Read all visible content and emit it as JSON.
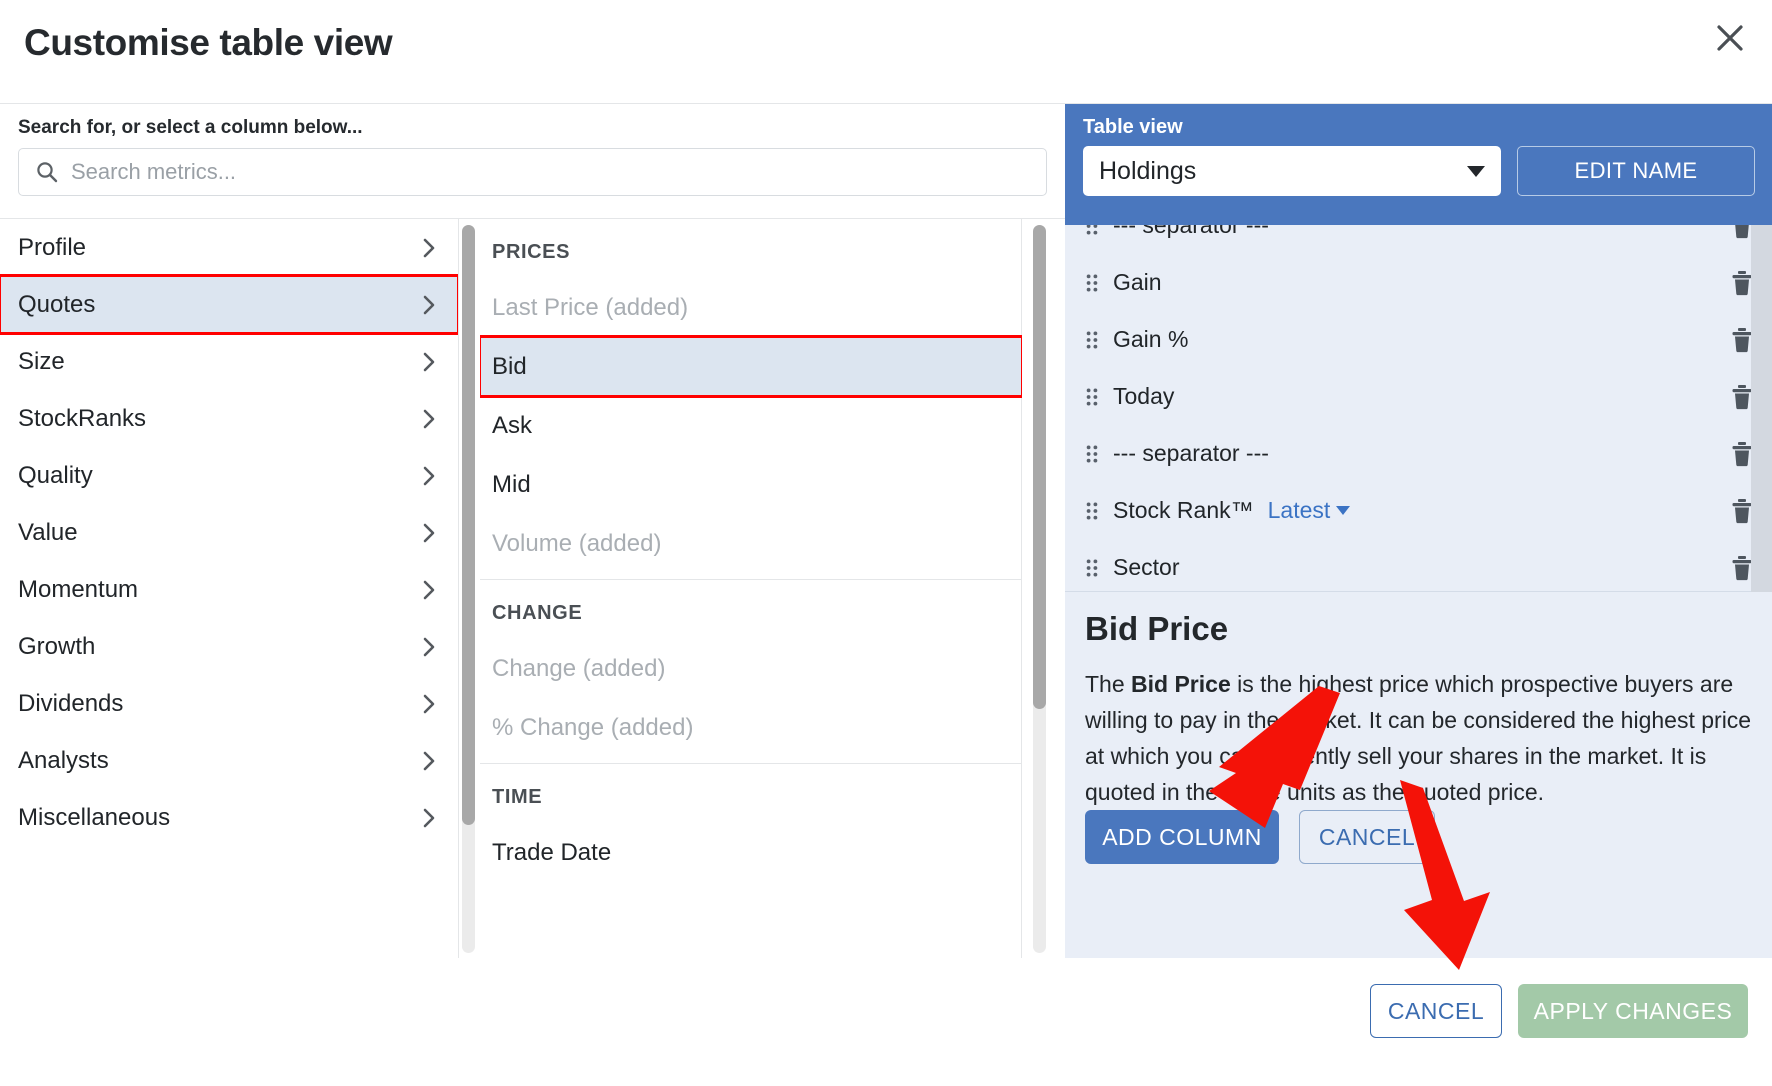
{
  "dialog": {
    "title": "Customise table view",
    "close_icon": "close-icon"
  },
  "search": {
    "label": "Search for, or select a column below...",
    "placeholder": "Search metrics...",
    "value": "",
    "icon": "search-icon"
  },
  "categories": [
    {
      "label": "Profile",
      "selected": false
    },
    {
      "label": "Quotes",
      "selected": true,
      "annotated": true
    },
    {
      "label": "Size",
      "selected": false
    },
    {
      "label": "StockRanks",
      "selected": false
    },
    {
      "label": "Quality",
      "selected": false
    },
    {
      "label": "Value",
      "selected": false
    },
    {
      "label": "Momentum",
      "selected": false
    },
    {
      "label": "Growth",
      "selected": false
    },
    {
      "label": "Dividends",
      "selected": false
    },
    {
      "label": "Analysts",
      "selected": false
    },
    {
      "label": "Miscellaneous",
      "selected": false
    }
  ],
  "metric_groups": [
    {
      "heading": "PRICES",
      "items": [
        {
          "label": "Last Price (added)",
          "added": true,
          "selected": false
        },
        {
          "label": "Bid",
          "added": false,
          "selected": true,
          "annotated": true
        },
        {
          "label": "Ask",
          "added": false,
          "selected": false
        },
        {
          "label": "Mid",
          "added": false,
          "selected": false
        },
        {
          "label": "Volume (added)",
          "added": true,
          "selected": false
        }
      ]
    },
    {
      "heading": "CHANGE",
      "items": [
        {
          "label": "Change (added)",
          "added": true,
          "selected": false
        },
        {
          "label": "% Change (added)",
          "added": true,
          "selected": false
        }
      ]
    },
    {
      "heading": "TIME",
      "items": [
        {
          "label": "Trade Date",
          "added": false,
          "selected": false
        }
      ]
    }
  ],
  "table_view": {
    "label": "Table view",
    "selected": "Holdings",
    "edit_name_label": "EDIT NAME",
    "caret_icon": "chevron-down-icon"
  },
  "selected_columns": [
    {
      "name": "--- separator ---",
      "period": ""
    },
    {
      "name": "Gain",
      "period": ""
    },
    {
      "name": "Gain %",
      "period": ""
    },
    {
      "name": "Today",
      "period": ""
    },
    {
      "name": "--- separator ---",
      "period": ""
    },
    {
      "name": "Stock Rank™",
      "period": "Latest"
    },
    {
      "name": "Sector",
      "period": ""
    }
  ],
  "description": {
    "title": "Bid Price",
    "lead": "The ",
    "term": "Bid Price",
    "rest": " is the highest price which prospective buyers are willing to pay in the market. It can be considered the highest price at which you can currently sell your shares in the market. It is quoted in the same units as the quoted price.",
    "add_label": "ADD COLUMN",
    "cancel_label": "CANCEL"
  },
  "footer": {
    "cancel_label": "CANCEL",
    "apply_label": "APPLY CHANGES"
  },
  "colors": {
    "accent_blue": "#4a77be",
    "highlight_row": "#dce5f0",
    "panel_bg": "#e9eef7",
    "annotation_red": "#ff0000",
    "apply_green": "#a3c9a8",
    "link_blue": "#3b73c4"
  }
}
